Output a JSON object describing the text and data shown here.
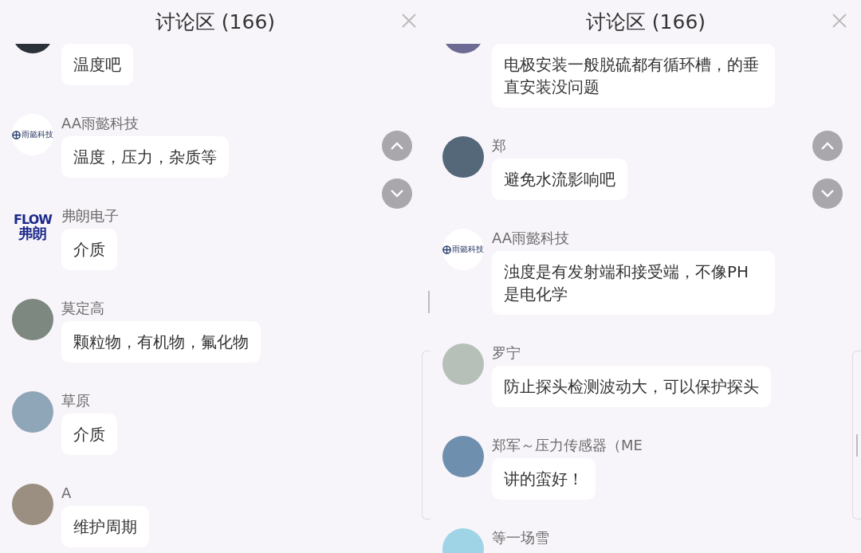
{
  "panels": [
    {
      "title": "讨论区 (166)",
      "messages": [
        {
          "avatar": {
            "kind": "photo",
            "color": "#2b3138"
          },
          "text": "温度吧"
        },
        {
          "author": "AA雨懿科技",
          "avatar": {
            "kind": "logo",
            "logo_text": [
              "雨懿科技"
            ]
          },
          "text": "温度，压力，杂质等"
        },
        {
          "author": "弗朗电子",
          "avatar": {
            "kind": "wordmark",
            "logo_text": [
              "FLOW",
              "弗朗"
            ]
          },
          "text": "介质"
        },
        {
          "author": "莫定高",
          "avatar": {
            "kind": "photo",
            "color": "#7d8880"
          },
          "text": "颗粒物，有机物，氟化物"
        },
        {
          "author": "草原",
          "avatar": {
            "kind": "photo",
            "color": "#8fa6b8"
          },
          "text": "介质"
        },
        {
          "author": "A",
          "avatar": {
            "kind": "photo",
            "color": "#9a8f80"
          },
          "text": "维护周期"
        }
      ]
    },
    {
      "title": "讨论区 (166)",
      "messages": [
        {
          "avatar": {
            "kind": "photo",
            "color": "#6d6a93"
          },
          "text": "电极安装一般脱硫都有循环槽，的垂直安装没问题"
        },
        {
          "author": "郑",
          "avatar": {
            "kind": "photo",
            "color": "#55687a"
          },
          "text": "避免水流影响吧"
        },
        {
          "author": "AA雨懿科技",
          "avatar": {
            "kind": "logo",
            "logo_text": [
              "雨懿科技"
            ]
          },
          "text": "浊度是有发射端和接受端，不像PH是电化学"
        },
        {
          "author": "罗宁",
          "avatar": {
            "kind": "photo",
            "color": "#b6c0b8"
          },
          "text": "防止探头检测波动大，可以保护探头"
        },
        {
          "author": "郑军～压力传感器（ME",
          "avatar": {
            "kind": "photo",
            "color": "#6f8fae"
          },
          "text": "讲的蛮好！"
        },
        {
          "author": "等一场雪",
          "avatar": {
            "kind": "photo",
            "color": "#9fd3e6"
          }
        }
      ]
    }
  ]
}
